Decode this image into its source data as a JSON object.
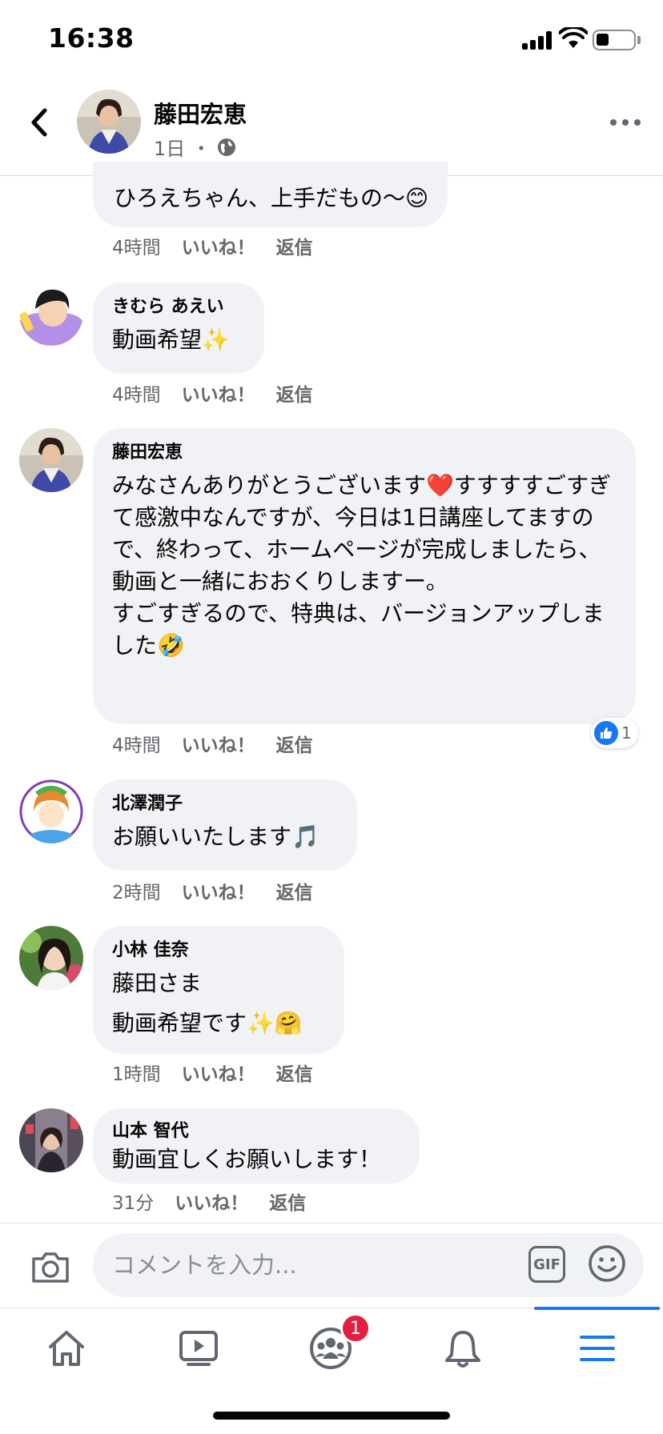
{
  "status_bar": {
    "time": "16:38"
  },
  "post_header": {
    "author": "藤田宏恵",
    "age": "1日",
    "separator": "・",
    "privacy_icon": "globe-icon",
    "more_icon": "more-horizontal-icon",
    "back_icon": "chevron-left-icon"
  },
  "comments": [
    {
      "author": "",
      "text": "ひろえちゃん、上手だもの〜😊",
      "time": "4時間",
      "like": "いいね！",
      "reply": "返信"
    },
    {
      "author": "きむら あえい",
      "text": "動画希望✨",
      "time": "4時間",
      "like": "いいね！",
      "reply": "返信"
    },
    {
      "author": "藤田宏恵",
      "text": "みなさんありがとうございます❤️すすすすごすぎて感激中なんですが、今日は1日講座してますので、終わって、ホームページが完成しましたら、動画と一緒におおくりしますー。",
      "text2": "すごすぎるので、特典は、バージョンアップしました🤣",
      "time": "4時間",
      "like": "いいね！",
      "reply": "返信",
      "reaction_count": "1"
    },
    {
      "author": "北澤潤子",
      "text": "お願いいたします🎵",
      "time": "2時間",
      "like": "いいね！",
      "reply": "返信"
    },
    {
      "author": "小林 佳奈",
      "text": "藤田さま",
      "text2": "動画希望です✨🤗",
      "time": "1時間",
      "like": "いいね！",
      "reply": "返信"
    },
    {
      "author": "山本 智代",
      "text": "動画宜しくお願いします！",
      "time": "31分",
      "like": "いいね！",
      "reply": "返信"
    }
  ],
  "composer": {
    "placeholder": "コメントを入力...",
    "gif_label": "GIF",
    "camera_icon": "camera-icon",
    "emoji_icon": "smiley-icon"
  },
  "tab_bar": {
    "tabs": [
      "home-icon",
      "watch-icon",
      "groups-icon",
      "bell-icon",
      "menu-icon"
    ],
    "groups_badge": "1",
    "active_tab": "menu",
    "accent_color": "#1877f2",
    "badge_color": "#e41e3f"
  }
}
